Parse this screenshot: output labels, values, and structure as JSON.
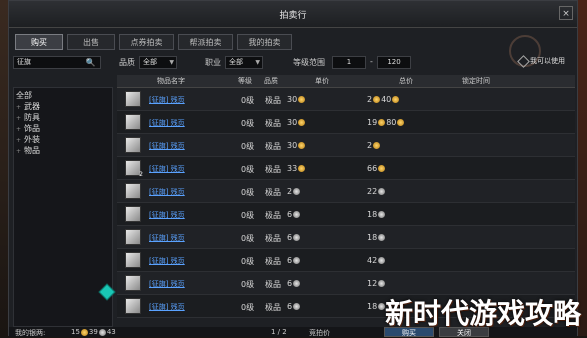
{
  "window": {
    "title": "拍卖行",
    "close_label": "×"
  },
  "tabs": [
    {
      "label": "购买",
      "active": true
    },
    {
      "label": "出售",
      "active": false
    },
    {
      "label": "点券拍卖",
      "active": false
    },
    {
      "label": "帮派拍卖",
      "active": false
    },
    {
      "label": "我的拍卖",
      "active": false
    }
  ],
  "filters": {
    "search_value": "征旗",
    "quality_label": "品质",
    "quality_value": "全部",
    "job_label": "职业",
    "job_value": "全部",
    "level_label": "等级范围",
    "level_min": "1",
    "level_sep": "-",
    "level_max": "120",
    "usable_label": "我可以使用"
  },
  "categories": [
    "全部",
    "武器",
    "防具",
    "饰品",
    "外装",
    "物品"
  ],
  "table": {
    "headers": {
      "name": "物品名字",
      "level": "等级",
      "quality": "品质",
      "unit_price": "单价",
      "total_price": "总价",
      "lock_time": "锁定时间"
    },
    "rows": [
      {
        "qty": "",
        "name": "[征旗] 残页",
        "level": "0级",
        "quality": "极品",
        "unit": "30",
        "unit_coin": "gold",
        "total_a": "2",
        "total_b": "40",
        "total_coin": "gold"
      },
      {
        "qty": "",
        "name": "[征旗] 残页",
        "level": "0级",
        "quality": "极品",
        "unit": "30",
        "unit_coin": "gold",
        "total_a": "19",
        "total_b": "80",
        "total_coin": "gold"
      },
      {
        "qty": "",
        "name": "[征旗] 残页",
        "level": "0级",
        "quality": "极品",
        "unit": "30",
        "unit_coin": "gold",
        "total_a": "2",
        "total_b": "",
        "total_coin": "gold"
      },
      {
        "qty": "2",
        "name": "[征旗] 残页",
        "level": "0级",
        "quality": "极品",
        "unit": "33",
        "unit_coin": "gold",
        "total_a": "66",
        "total_b": "",
        "total_coin": "gold"
      },
      {
        "qty": "",
        "name": "[征旗] 残页",
        "level": "0级",
        "quality": "极品",
        "unit": "2",
        "unit_coin": "silver",
        "total_a": "22",
        "total_b": "",
        "total_coin": "silver"
      },
      {
        "qty": "",
        "name": "[征旗] 残页",
        "level": "0级",
        "quality": "极品",
        "unit": "6",
        "unit_coin": "silver",
        "total_a": "18",
        "total_b": "",
        "total_coin": "silver"
      },
      {
        "qty": "",
        "name": "[征旗] 残页",
        "level": "0级",
        "quality": "极品",
        "unit": "6",
        "unit_coin": "silver",
        "total_a": "18",
        "total_b": "",
        "total_coin": "silver"
      },
      {
        "qty": "",
        "name": "[征旗] 残页",
        "level": "0级",
        "quality": "极品",
        "unit": "6",
        "unit_coin": "silver",
        "total_a": "42",
        "total_b": "",
        "total_coin": "silver"
      },
      {
        "qty": "",
        "name": "[征旗] 残页",
        "level": "0级",
        "quality": "极品",
        "unit": "6",
        "unit_coin": "silver",
        "total_a": "12",
        "total_b": "",
        "total_coin": "silver"
      },
      {
        "qty": "",
        "name": "[征旗] 残页",
        "level": "0级",
        "quality": "极品",
        "unit": "6",
        "unit_coin": "silver",
        "total_a": "18",
        "total_b": "",
        "total_coin": "silver"
      }
    ]
  },
  "bottom": {
    "money_label": "我的银两:",
    "money_a": "15",
    "money_b": "39",
    "money_c": "43",
    "page": "1 / 2",
    "bid_label": "竞拍价",
    "buy_label": "购买",
    "close_label": "关闭"
  },
  "watermark": "新时代游戏攻略",
  "colors": {
    "link": "#5aa2ff",
    "gold": "#d9a52b",
    "accent_teal": "#19c7b5"
  }
}
